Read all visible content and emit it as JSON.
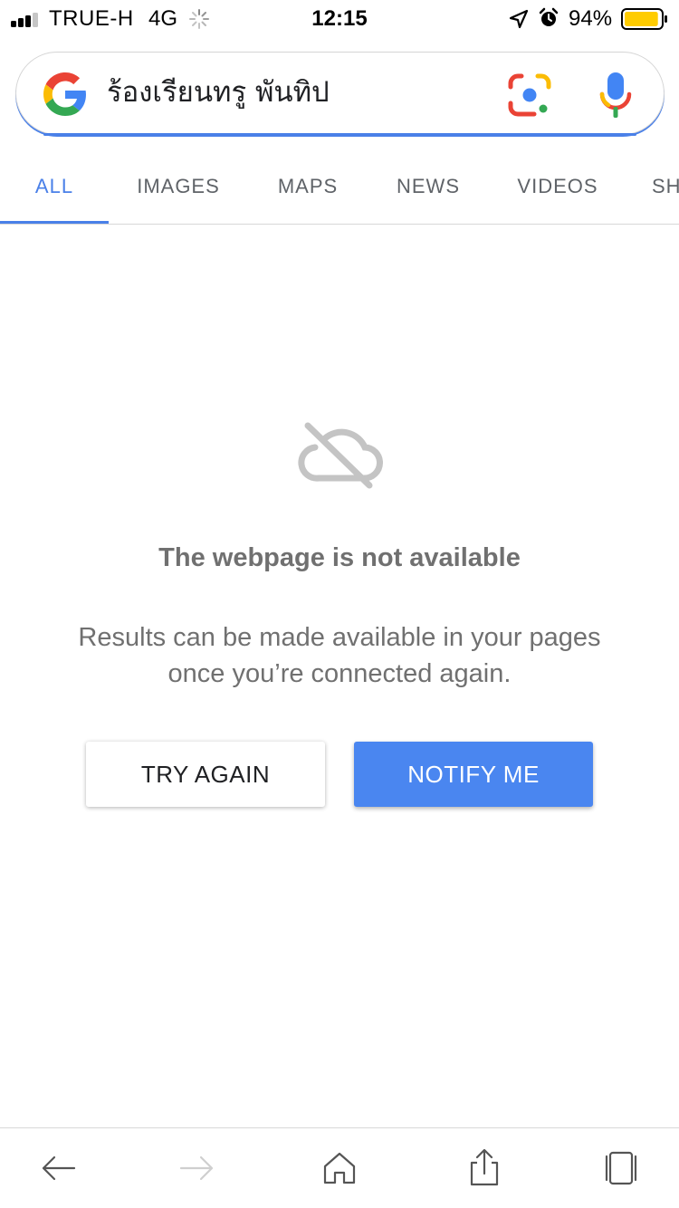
{
  "status_bar": {
    "carrier": "TRUE-H",
    "network": "4G",
    "time": "12:15",
    "battery": "94%",
    "battery_level": 0.94,
    "battery_color": "#FFCC00"
  },
  "search": {
    "query": "ร้องเรียนทรู พันทิป",
    "logo_icon": "google-g-icon",
    "lens_icon": "google-lens-icon",
    "mic_icon": "microphone-icon",
    "accent_color": "#4A80E8"
  },
  "tabs": [
    {
      "label": "ALL",
      "active": true
    },
    {
      "label": "IMAGES",
      "active": false
    },
    {
      "label": "MAPS",
      "active": false
    },
    {
      "label": "NEWS",
      "active": false
    },
    {
      "label": "VIDEOS",
      "active": false
    },
    {
      "label": "SH",
      "active": false
    }
  ],
  "offline": {
    "icon": "cloud-off-icon",
    "title": "The webpage is not available",
    "body_line1": "Results can be made available in your pages",
    "body_line2": "once you’re connected again.",
    "try_again_label": "TRY AGAIN",
    "notify_label": "NOTIFY ME",
    "notify_color": "#4A86F0"
  },
  "toolbar": {
    "items": [
      {
        "icon": "back-arrow-icon",
        "enabled": true
      },
      {
        "icon": "forward-arrow-icon",
        "enabled": false
      },
      {
        "icon": "home-icon",
        "enabled": true
      },
      {
        "icon": "share-icon",
        "enabled": true
      },
      {
        "icon": "tabs-icon",
        "enabled": true
      }
    ]
  }
}
